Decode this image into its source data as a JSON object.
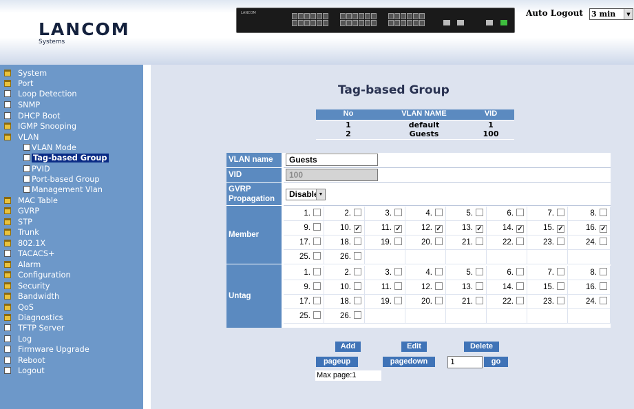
{
  "header": {
    "logo": "LANCOM",
    "logo_sub": "Systems",
    "switch_brand": "LANCOM",
    "auto_logout_label": "Auto Logout",
    "auto_logout_value": "3 min"
  },
  "sidebar": {
    "items": [
      {
        "label": "System",
        "icon": "folder-icon",
        "indent": 0
      },
      {
        "label": "Port",
        "icon": "folder-icon",
        "indent": 0
      },
      {
        "label": "Loop Detection",
        "icon": "page-icon",
        "indent": 0
      },
      {
        "label": "SNMP",
        "icon": "page-icon",
        "indent": 0
      },
      {
        "label": "DHCP Boot",
        "icon": "page-icon",
        "indent": 0
      },
      {
        "label": "IGMP Snooping",
        "icon": "folder-icon",
        "indent": 0
      },
      {
        "label": "VLAN",
        "icon": "folder-open-icon",
        "indent": 0
      },
      {
        "label": "VLAN Mode",
        "icon": "page-icon",
        "indent": 1
      },
      {
        "label": "Tag-based Group",
        "icon": "page-icon",
        "indent": 1,
        "active": true
      },
      {
        "label": "PVID",
        "icon": "page-icon",
        "indent": 1
      },
      {
        "label": "Port-based Group",
        "icon": "page-icon",
        "indent": 1
      },
      {
        "label": "Management Vlan",
        "icon": "page-icon",
        "indent": 1
      },
      {
        "label": "MAC Table",
        "icon": "folder-icon",
        "indent": 0
      },
      {
        "label": "GVRP",
        "icon": "folder-icon",
        "indent": 0
      },
      {
        "label": "STP",
        "icon": "folder-icon",
        "indent": 0
      },
      {
        "label": "Trunk",
        "icon": "folder-icon",
        "indent": 0
      },
      {
        "label": "802.1X",
        "icon": "folder-icon",
        "indent": 0
      },
      {
        "label": "TACACS+",
        "icon": "page-icon",
        "indent": 0
      },
      {
        "label": "Alarm",
        "icon": "folder-icon",
        "indent": 0
      },
      {
        "label": "Configuration",
        "icon": "folder-icon",
        "indent": 0
      },
      {
        "label": "Security",
        "icon": "folder-icon",
        "indent": 0
      },
      {
        "label": "Bandwidth",
        "icon": "folder-icon",
        "indent": 0
      },
      {
        "label": "QoS",
        "icon": "folder-icon",
        "indent": 0
      },
      {
        "label": "Diagnostics",
        "icon": "folder-icon",
        "indent": 0
      },
      {
        "label": "TFTP Server",
        "icon": "page-icon",
        "indent": 0
      },
      {
        "label": "Log",
        "icon": "page-icon",
        "indent": 0
      },
      {
        "label": "Firmware Upgrade",
        "icon": "page-icon",
        "indent": 0
      },
      {
        "label": "Reboot",
        "icon": "page-icon",
        "indent": 0
      },
      {
        "label": "Logout",
        "icon": "page-icon",
        "indent": 0
      }
    ]
  },
  "main": {
    "title": "Tag-based Group",
    "vlan_table": {
      "headers": [
        "No",
        "VLAN NAME",
        "VID"
      ],
      "rows": [
        [
          "1",
          "default",
          "1"
        ],
        [
          "2",
          "Guests",
          "100"
        ]
      ]
    },
    "form": {
      "vlan_name_label": "VLAN name",
      "vlan_name_value": "Guests",
      "vid_label": "VID",
      "vid_value": "100",
      "gvrp_label_1": "GVRP",
      "gvrp_label_2": "Propagation",
      "gvrp_value": "Disable",
      "member_label": "Member",
      "untag_label": "Untag",
      "member_checked": [
        10,
        11,
        12,
        13,
        14,
        15,
        16
      ],
      "untag_checked": []
    },
    "buttons": {
      "add": "Add",
      "edit": "Edit",
      "delete": "Delete",
      "pageup": "pageup",
      "pagedown": "pagedown",
      "go": "go",
      "page_value": "1",
      "max_page": "Max page:1"
    }
  },
  "colors": {
    "sidebar_bg": "#6d98c9",
    "main_bg": "#dde3ef",
    "header_cell": "#5b8ac0",
    "button": "#3f73b7",
    "active_nav": "#0a2b85"
  }
}
